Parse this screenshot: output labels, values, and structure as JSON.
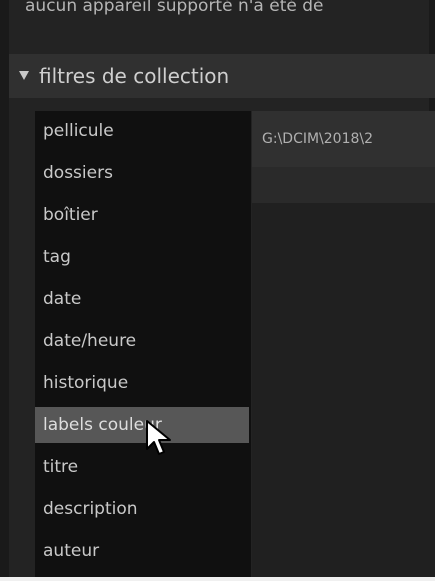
{
  "top_message": "aucun appareil supporté n'a été dé",
  "section": {
    "title": "filtres de collection",
    "items": [
      "pellicule",
      "dossiers",
      "boîtier",
      "tag",
      "date",
      "date/heure",
      "historique",
      "labels couleur",
      "titre",
      "description",
      "auteur"
    ],
    "selected_index": 7
  },
  "path": {
    "value": "G:\\DCIM\\2018\\2"
  }
}
